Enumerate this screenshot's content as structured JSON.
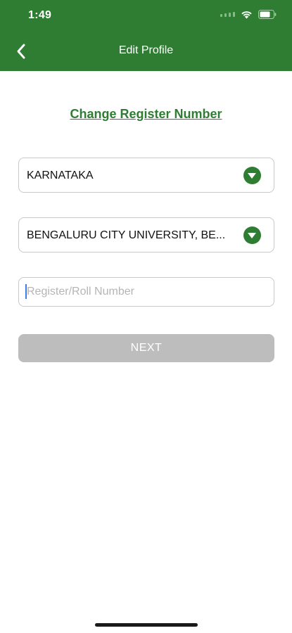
{
  "status_bar": {
    "time": "1:49",
    "icons": [
      "signal-icon",
      "wifi-icon",
      "battery-icon"
    ]
  },
  "header": {
    "title": "Edit Profile",
    "back_icon": "chevron-left-icon"
  },
  "main": {
    "change_link": "Change Register Number",
    "state_select": {
      "value": "KARNATAKA"
    },
    "university_select": {
      "value": "BENGALURU CITY UNIVERSITY, BE..."
    },
    "register_input": {
      "value": "",
      "placeholder": "Register/Roll Number"
    },
    "next_button": "NEXT"
  },
  "colors": {
    "primary_green": "#2e7d32",
    "disabled_button": "#bdbdbd",
    "border": "#c9c9c9"
  }
}
